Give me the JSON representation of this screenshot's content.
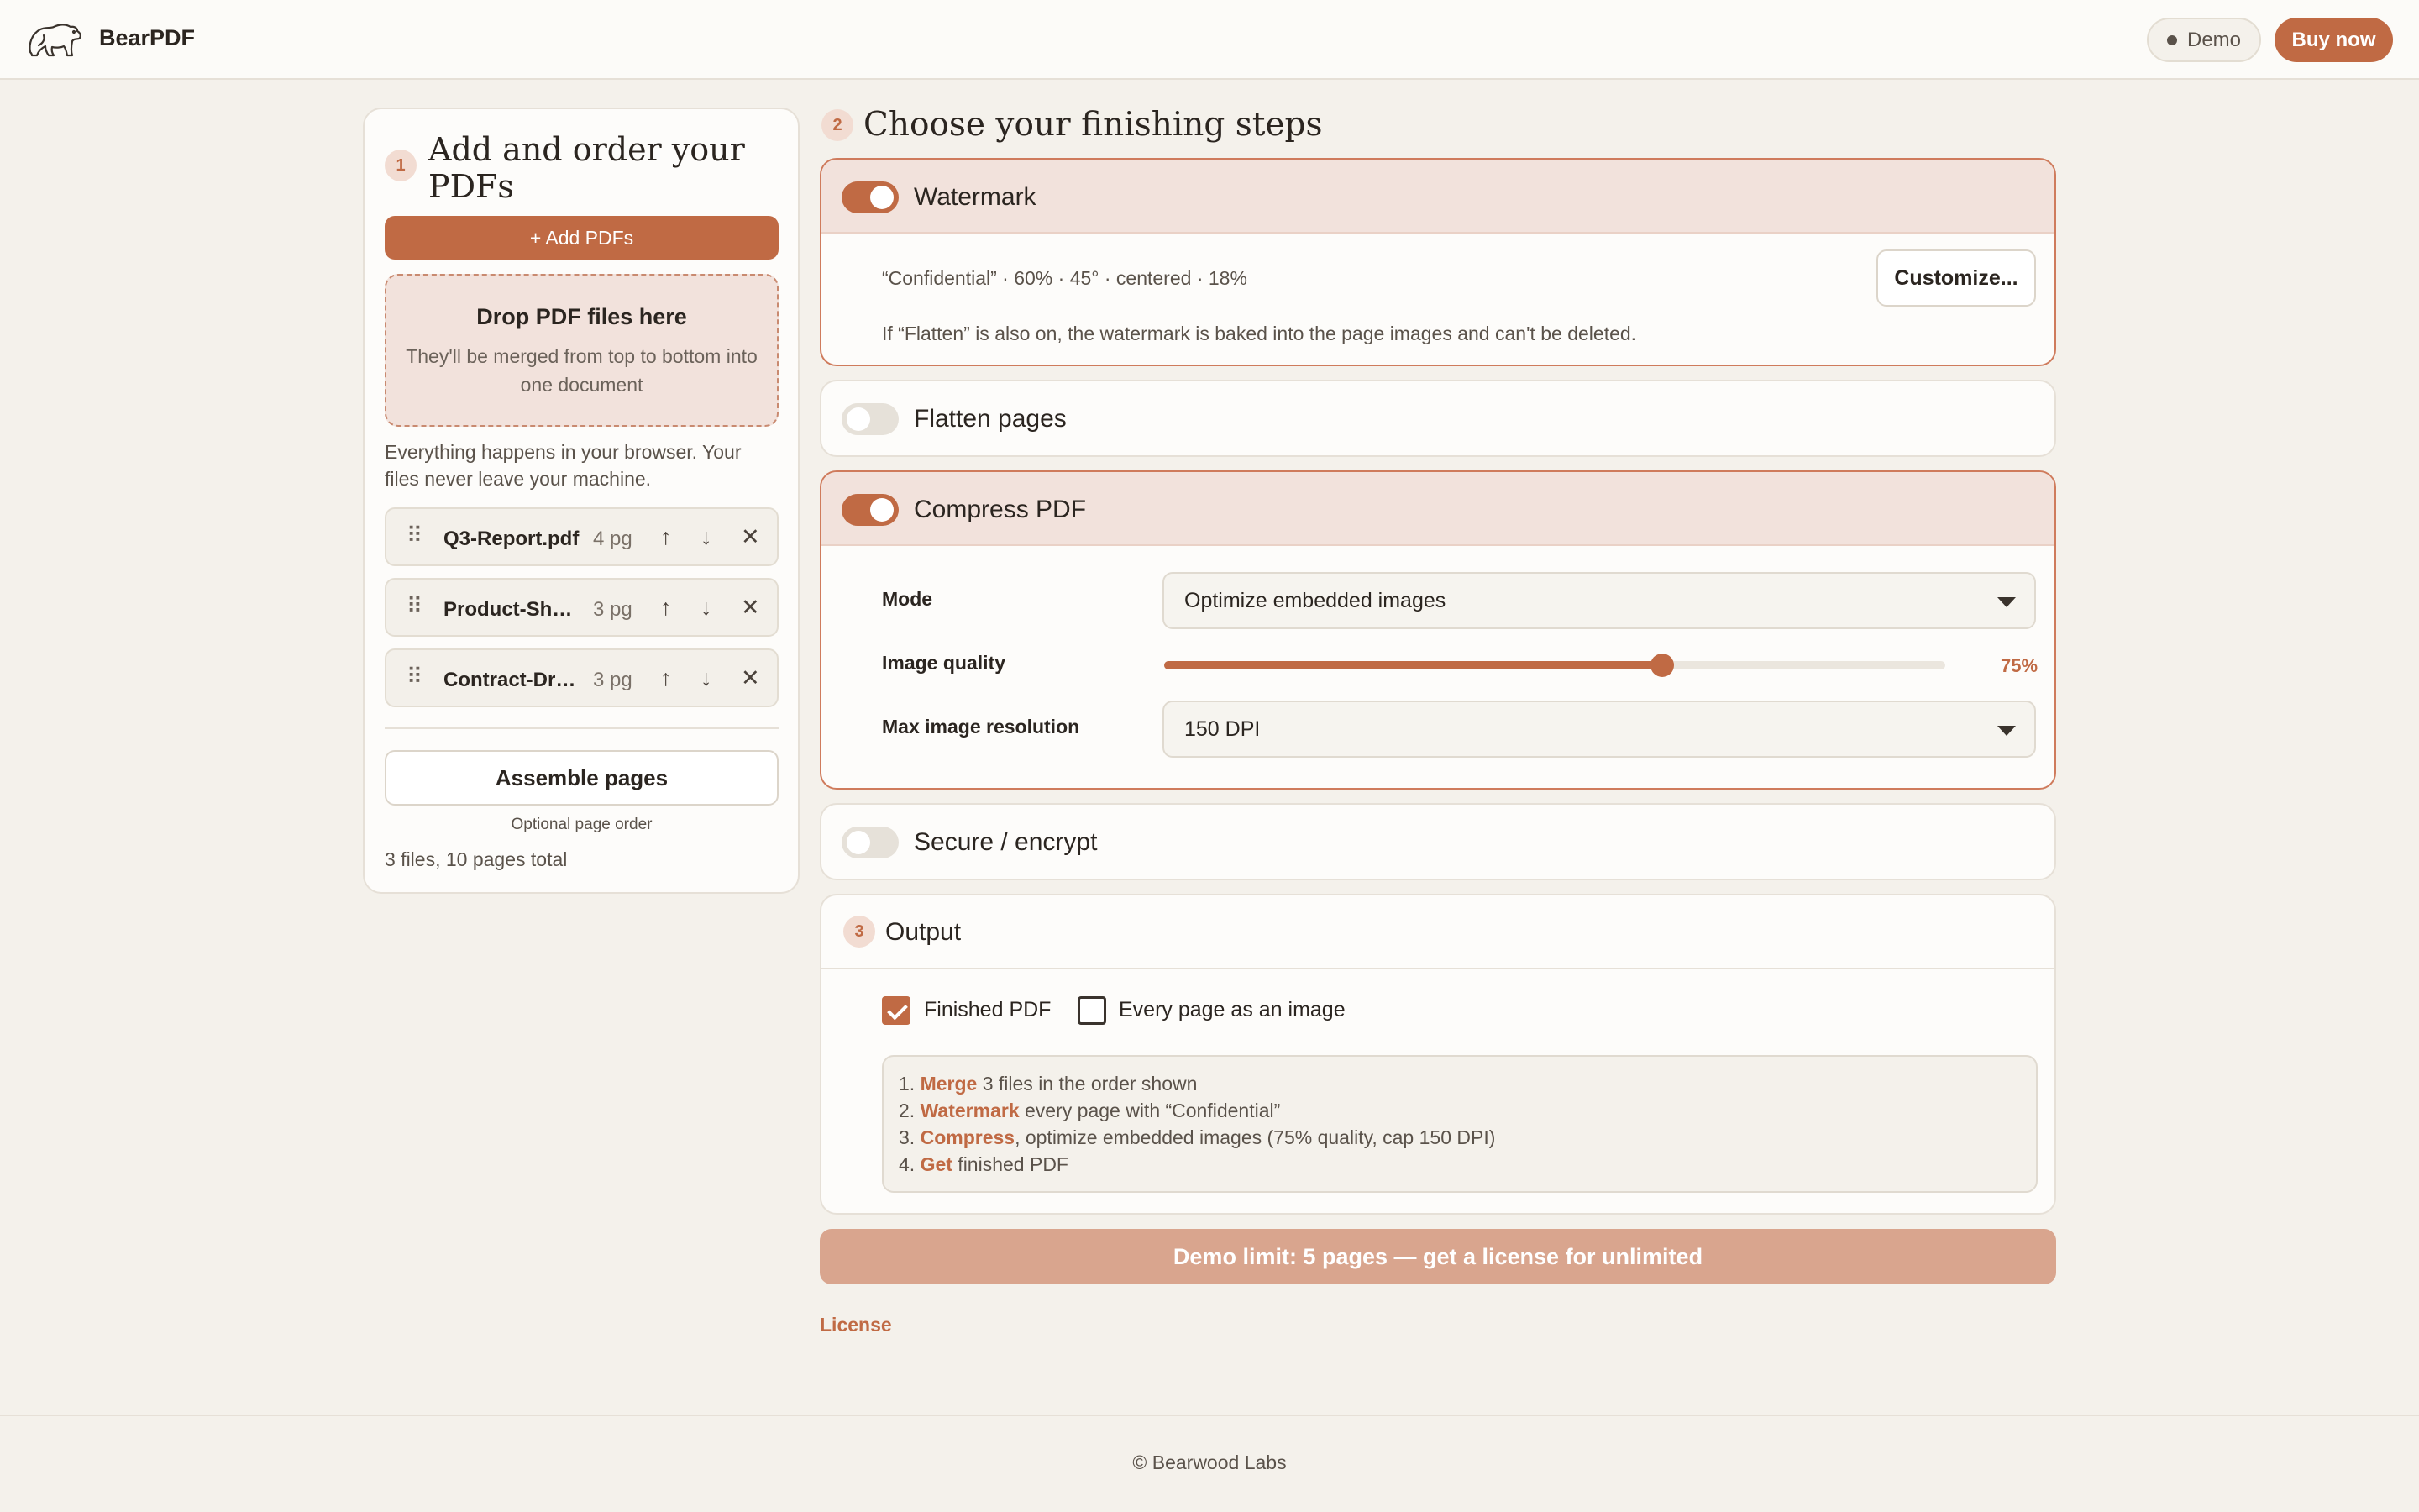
{
  "header": {
    "brand": "BearPDF",
    "demo_label": "Demo",
    "buy_label": "Buy now"
  },
  "step1": {
    "number": "1",
    "title": "Add and order your PDFs",
    "add_button": "+ Add PDFs",
    "dropzone_title": "Drop PDF files here",
    "dropzone_subtitle": "They'll be merged from top to bottom into one document",
    "privacy_note": "Everything happens in your browser. Your files never leave your machine.",
    "files": [
      {
        "name": "Q3-Report.pdf",
        "pages": "4 pg"
      },
      {
        "name": "Product-Sheet.pdf",
        "pages": "3 pg"
      },
      {
        "name": "Contract-Draft.pdf",
        "pages": "3 pg"
      }
    ],
    "assemble_button": "Assemble pages",
    "optional_note": "Optional page order",
    "total": "3 files, 10 pages total"
  },
  "step2": {
    "number": "2",
    "title": "Choose your finishing steps",
    "watermark": {
      "label": "Watermark",
      "enabled": true,
      "summary": "“Confidential” · 60% · 45° · centered · 18%",
      "customize_button": "Customize...",
      "note": "If “Flatten” is also on, the watermark is baked into the page images and can't be deleted."
    },
    "flatten": {
      "label": "Flatten pages",
      "enabled": false
    },
    "compress": {
      "label": "Compress PDF",
      "enabled": true,
      "mode_label": "Mode",
      "mode_value": "Optimize embedded images",
      "quality_label": "Image quality",
      "quality_percent": 75,
      "quality_display": "75%",
      "resolution_label": "Max image resolution",
      "resolution_value": "150 DPI"
    },
    "secure": {
      "label": "Secure / encrypt",
      "enabled": false
    }
  },
  "step3": {
    "number": "3",
    "title": "Output",
    "finished_pdf_label": "Finished PDF",
    "finished_pdf_checked": true,
    "images_label": "Every page as an image",
    "images_checked": false,
    "summary": [
      {
        "prefix": "1. ",
        "verb": "Merge",
        "rest": " 3 files in the order shown"
      },
      {
        "prefix": "2. ",
        "verb": "Watermark",
        "rest": " every page with “Confidential”"
      },
      {
        "prefix": "3. ",
        "verb": "Compress",
        "rest": ", optimize embedded images (75% quality, cap 150 DPI)"
      },
      {
        "prefix": "4. ",
        "verb": "Get",
        "rest": " finished PDF"
      }
    ]
  },
  "demo_banner": "Demo limit: 5 pages — get a license for unlimited",
  "license_link": "License",
  "footer": "© Bearwood Labs",
  "colors": {
    "accent": "#c06a44",
    "background": "#f4f1eb",
    "active_panel": "#f2e2dc"
  }
}
